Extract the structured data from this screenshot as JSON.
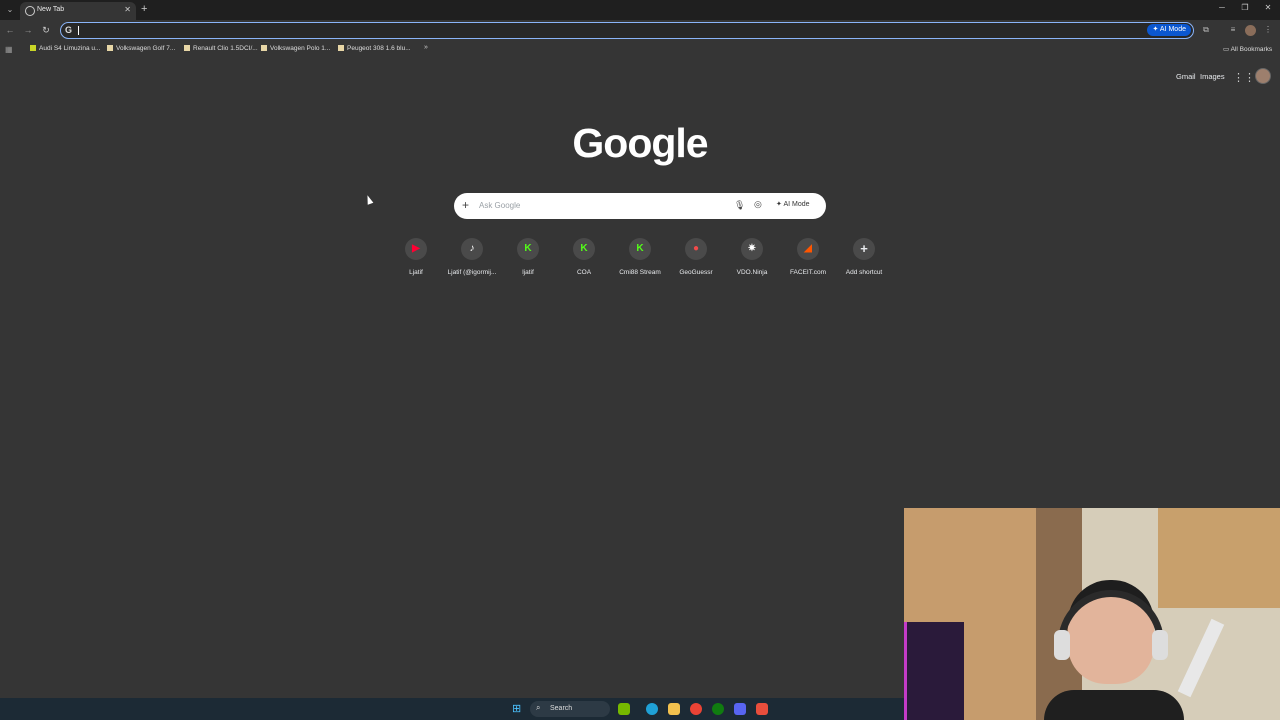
{
  "browser": {
    "tab": {
      "title": "New Tab"
    },
    "omnibox": {
      "value": "",
      "ai_mode_label": "AI Mode"
    },
    "bookmarks": [
      {
        "label": "Audi S4 Limuzina u..."
      },
      {
        "label": "Volkswagen Golf 7..."
      },
      {
        "label": "Renault Clio 1.5DCI/..."
      },
      {
        "label": "Volkswagen Polo 1..."
      },
      {
        "label": "Peugeot 308 1.6 blu..."
      }
    ],
    "bookmarks_more": "»",
    "all_bookmarks_label": "All Bookmarks"
  },
  "google": {
    "top_links": {
      "gmail": "Gmail",
      "images": "Images"
    },
    "logo": "Google",
    "search": {
      "placeholder": "Ask Google",
      "ai_mode_label": "AI Mode"
    },
    "shortcuts": [
      {
        "label": "Ljatif",
        "glyph": "▶",
        "color": "#ff0033"
      },
      {
        "label": "Ljatif (@igormij...",
        "glyph": "♪",
        "color": "#ffffff"
      },
      {
        "label": "ljatif",
        "glyph": "K",
        "color": "#53fc18"
      },
      {
        "label": "COA",
        "glyph": "K",
        "color": "#53fc18"
      },
      {
        "label": "Cmi88 Stream",
        "glyph": "K",
        "color": "#53fc18"
      },
      {
        "label": "GeoGuessr",
        "glyph": "●",
        "color": "#f24a4a"
      },
      {
        "label": "VDO.Ninja",
        "glyph": "✷",
        "color": "#ffffff"
      },
      {
        "label": "FACEIT.com",
        "glyph": "◢",
        "color": "#ff5500"
      },
      {
        "label": "Add shortcut",
        "glyph": "+",
        "color": "#e8eaed"
      }
    ]
  },
  "taskbar": {
    "search_label": "Search",
    "apps": [
      {
        "name": "nvidia",
        "color": "#76b900"
      },
      {
        "name": "edge",
        "color": "#1fa1d7"
      },
      {
        "name": "file-explorer",
        "color": "#f2c14e"
      },
      {
        "name": "chrome",
        "color": "#ea4335"
      },
      {
        "name": "xbox",
        "color": "#107c10"
      },
      {
        "name": "discord",
        "color": "#5865f2"
      },
      {
        "name": "app",
        "color": "#e94e3c"
      }
    ]
  }
}
